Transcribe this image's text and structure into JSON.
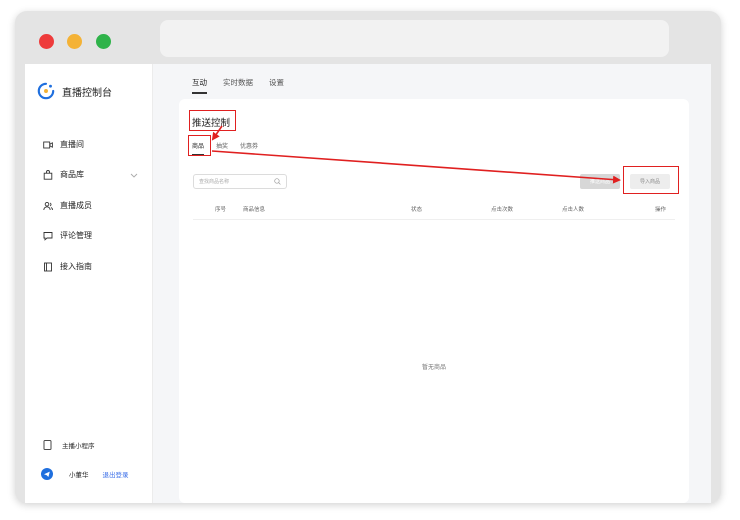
{
  "sidebar": {
    "logo_title": "直播控制台",
    "items": [
      {
        "label": "直播间",
        "icon": "video-icon"
      },
      {
        "label": "商品库",
        "icon": "bag-icon"
      },
      {
        "label": "直播成员",
        "icon": "users-icon"
      },
      {
        "label": "评论管理",
        "icon": "comment-icon"
      },
      {
        "label": "接入指南",
        "icon": "book-icon"
      }
    ],
    "mini_program_label": "主播小程序",
    "user_name": "小董华",
    "logout_label": "退出登录"
  },
  "top_tabs": [
    "互动",
    "实时数据",
    "设置"
  ],
  "panel": {
    "title": "推送控制",
    "sub_tabs": [
      "商品",
      "抽奖",
      "优惠券"
    ],
    "search_placeholder": "查找商品名称",
    "push_button": "推送商品",
    "import_button": "导入商品",
    "columns": [
      "序号",
      "商品信息",
      "状态",
      "点击次数",
      "点击人数",
      "操作"
    ],
    "empty_text": "暂无商品"
  },
  "colors": {
    "accent_red": "#e02020",
    "red_dot": "#ee3b3b",
    "yellow_dot": "#f4b236",
    "green_dot": "#2fb34a",
    "logo_blue": "#1f6fde",
    "link_blue": "#3a6ee8"
  }
}
